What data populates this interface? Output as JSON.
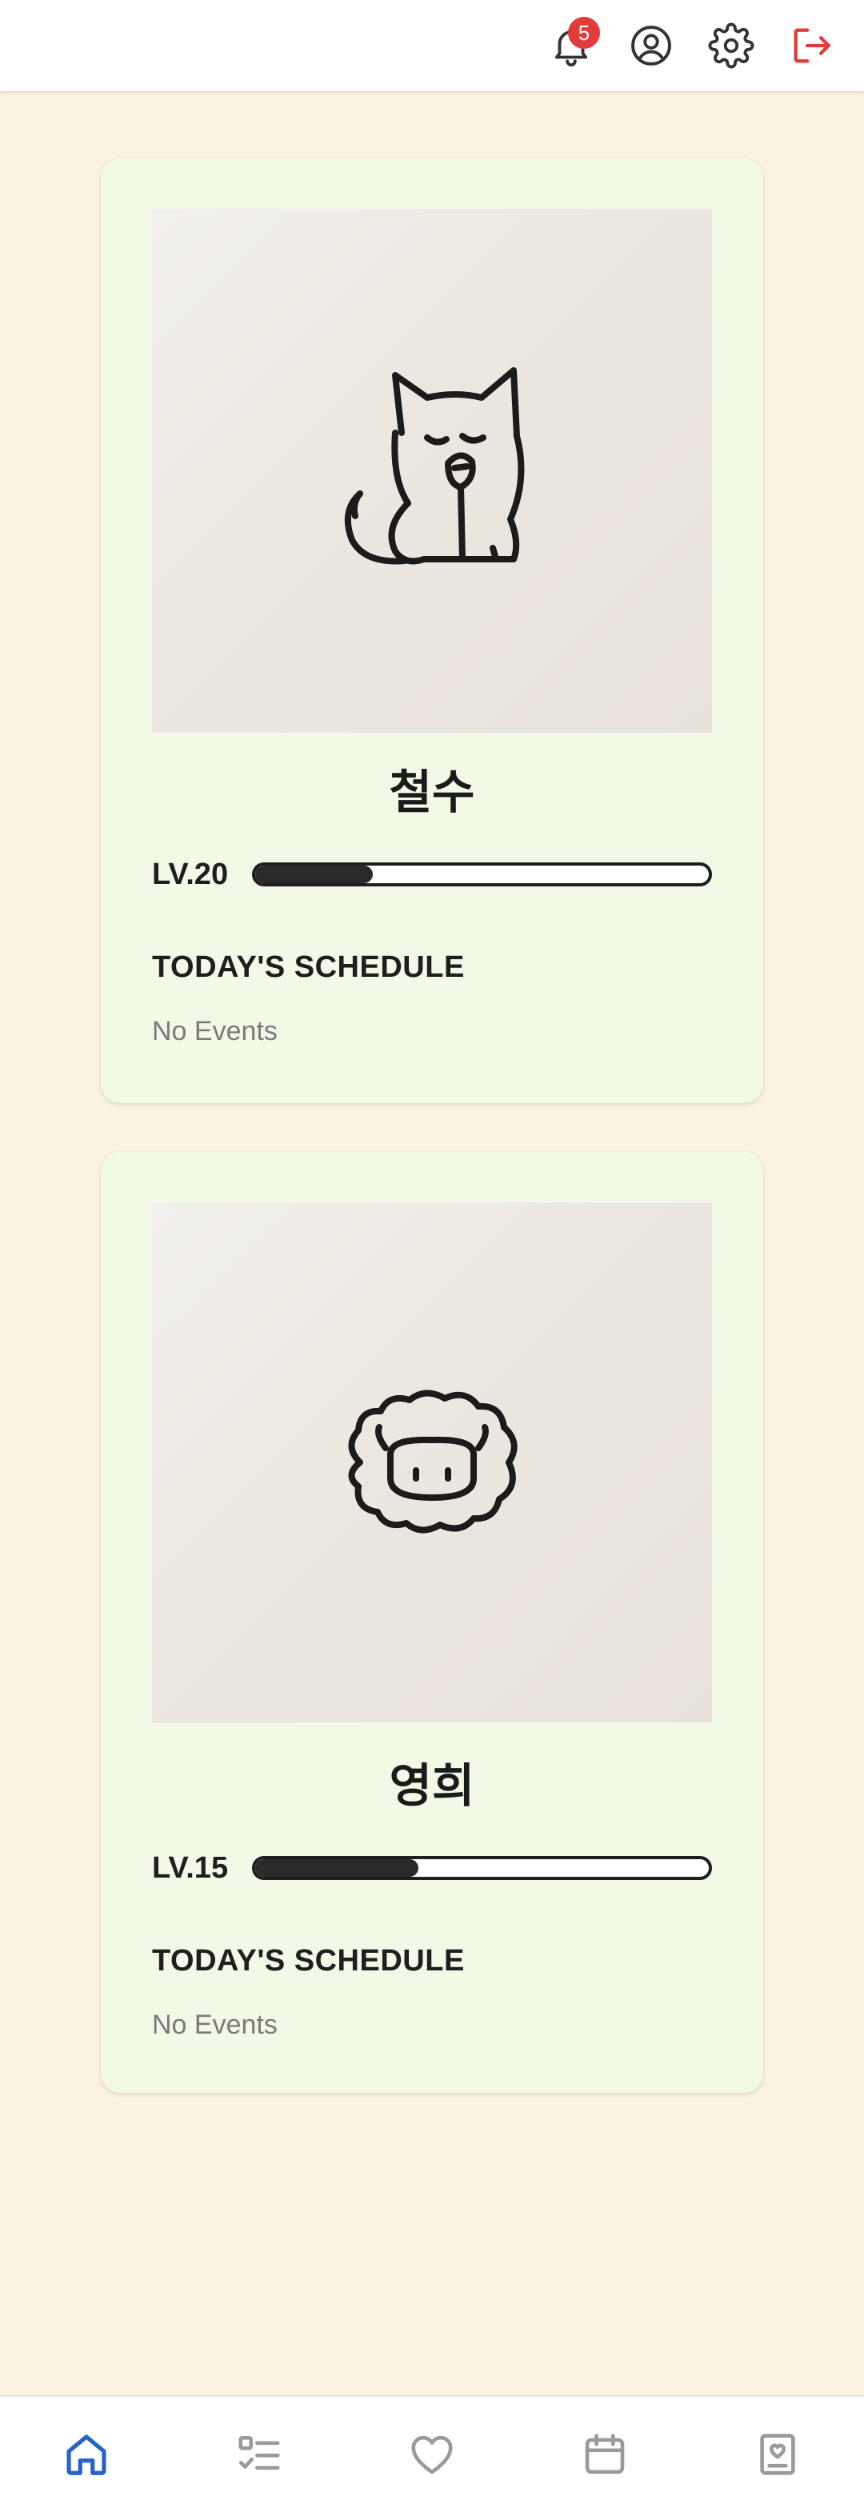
{
  "header": {
    "notification_count": "5",
    "icons": [
      "bell-icon",
      "user-circle-icon",
      "gear-icon",
      "logout-icon"
    ],
    "logout_color": "#e03c3c"
  },
  "characters": [
    {
      "name": "철수",
      "level_label": "LV.20",
      "level_progress": 0.26,
      "avatar": "cat-drawing",
      "schedule_title": "TODAY'S SCHEDULE",
      "schedule_empty": "No Events"
    },
    {
      "name": "영희",
      "level_label": "LV.15",
      "level_progress": 0.36,
      "avatar": "sheep-drawing",
      "schedule_title": "TODAY'S SCHEDULE",
      "schedule_empty": "No Events"
    }
  ],
  "bottom_nav": {
    "items": [
      "home-icon",
      "checklist-icon",
      "heart-icon",
      "calendar-icon",
      "diary-icon"
    ],
    "active": "home-icon",
    "active_color": "#2563c9",
    "inactive_color": "#9a9a9a"
  }
}
